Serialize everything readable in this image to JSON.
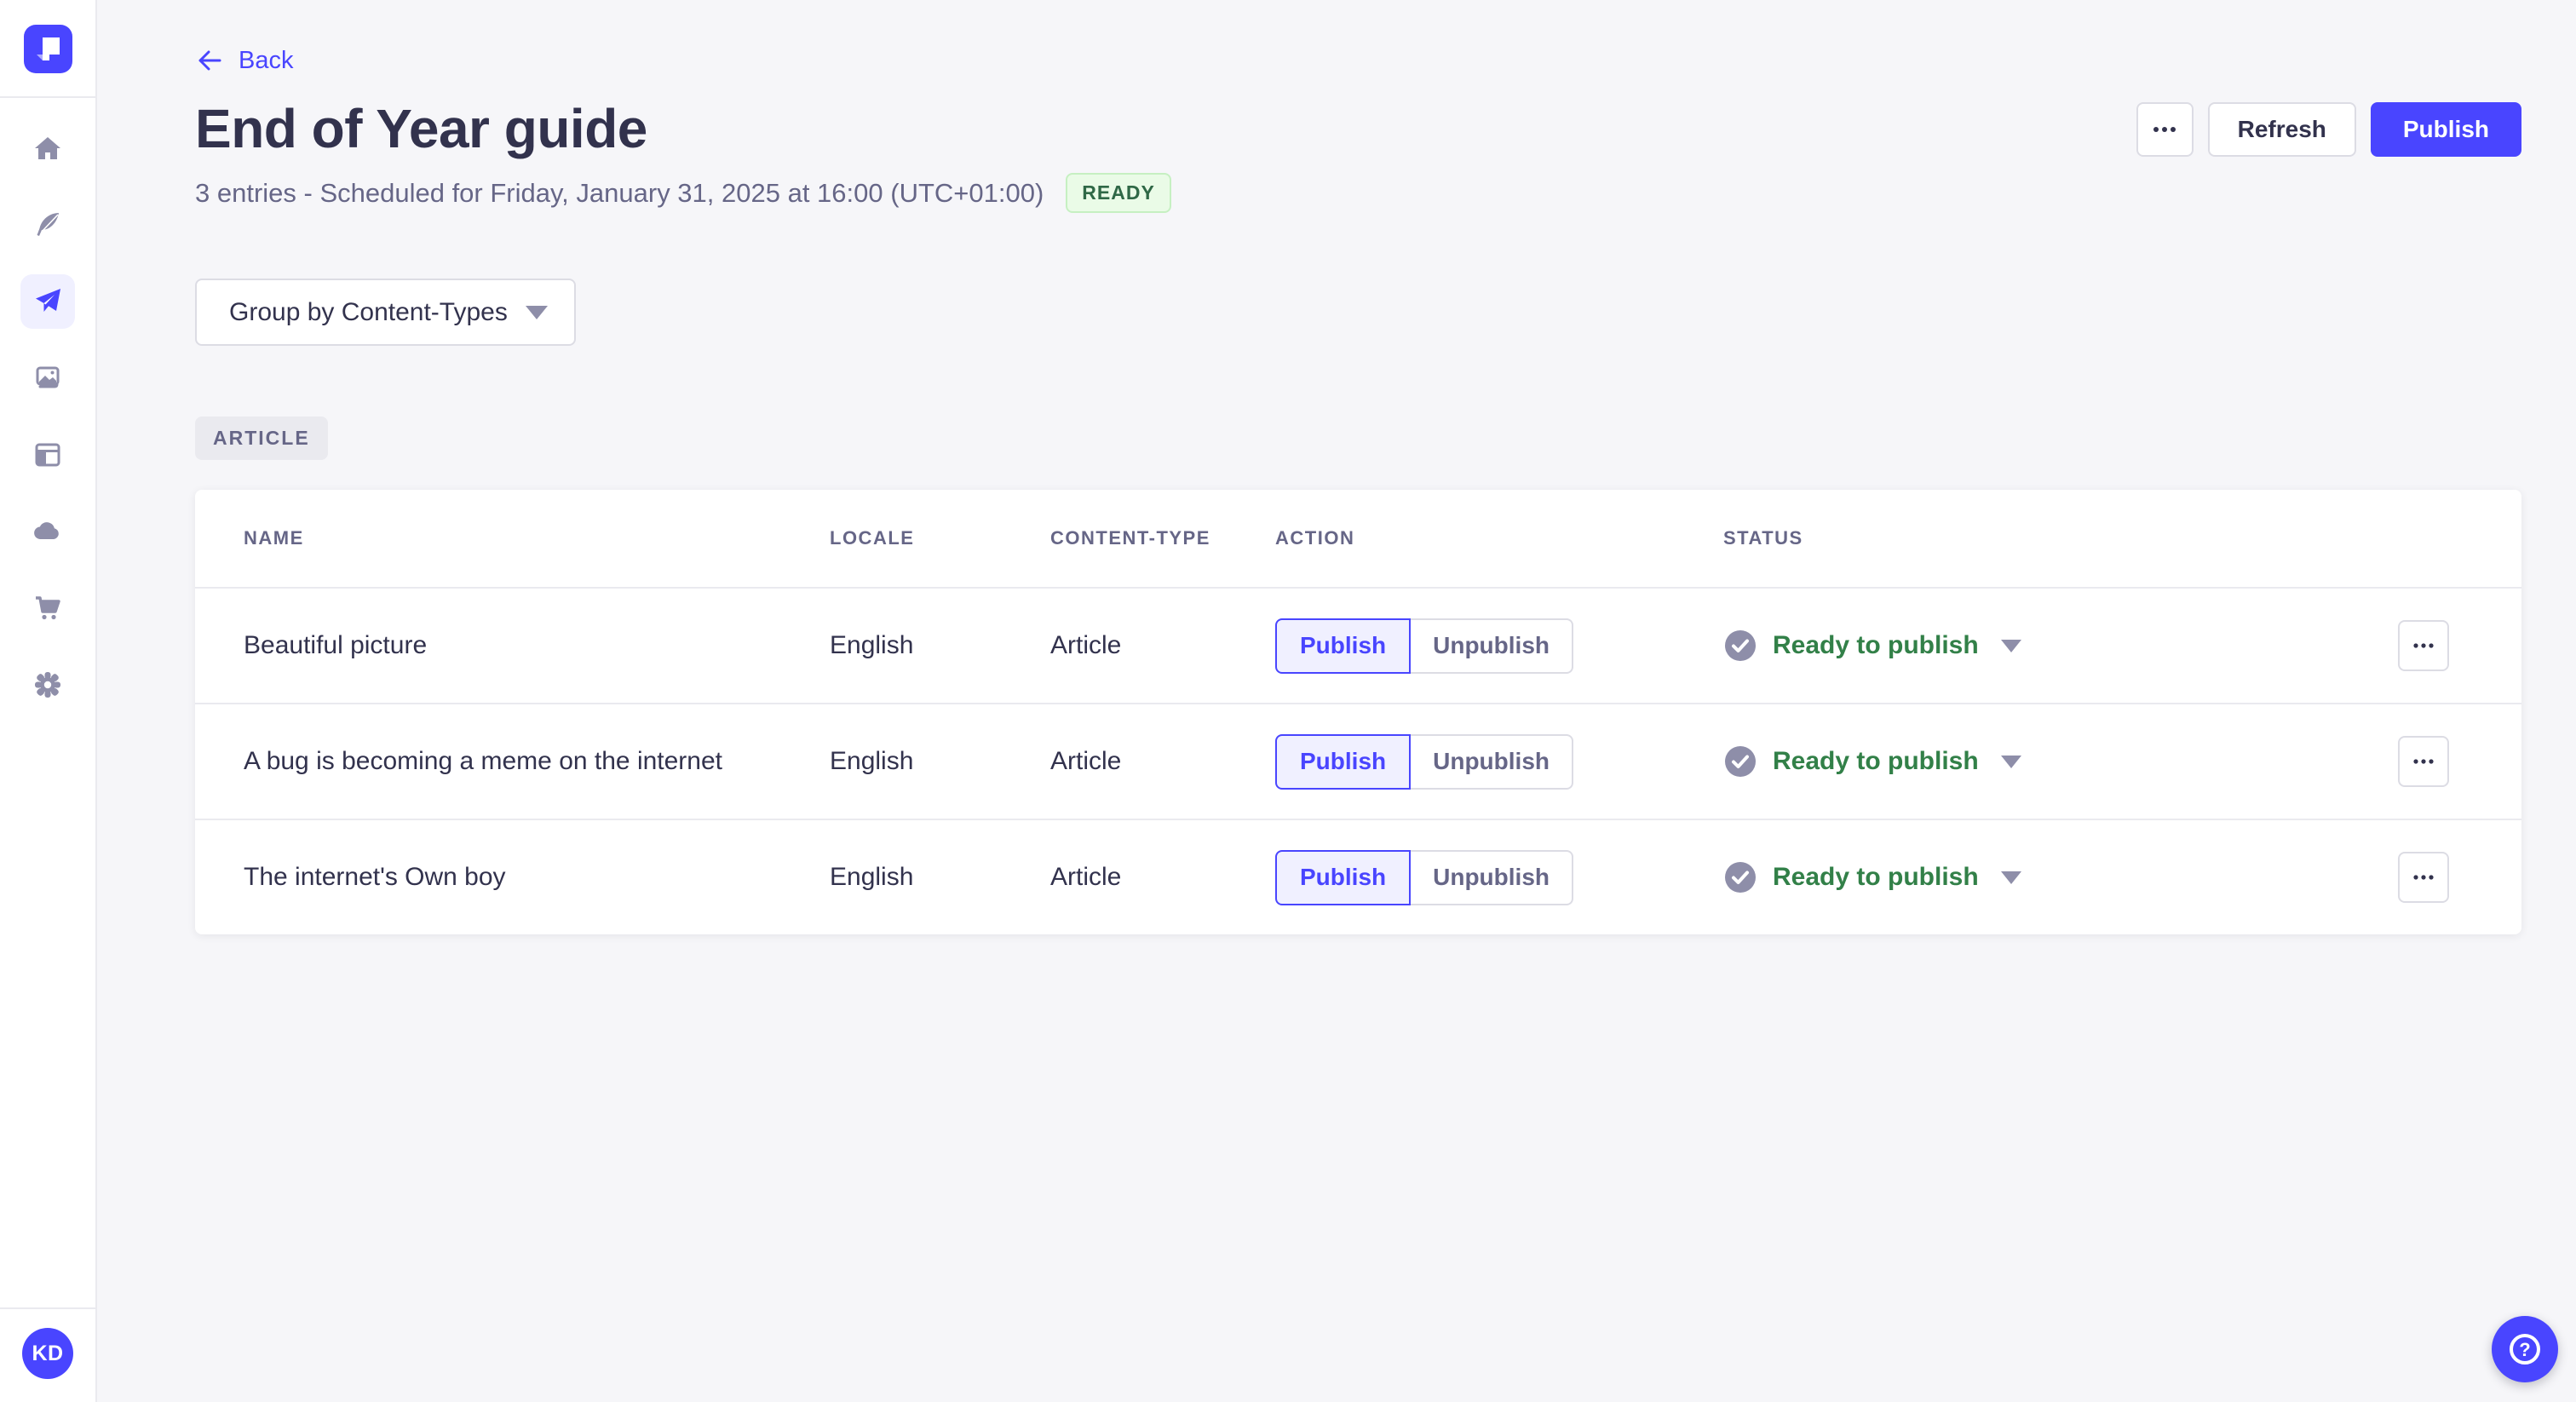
{
  "colors": {
    "primary": "#4945ff",
    "primary_light_bg": "#f0f0ff",
    "text_dark": "#32324d",
    "text_gray": "#666687",
    "icon_gray": "#8e8ea9",
    "border": "#dcdce4",
    "divider": "#eaeaef",
    "page_bg": "#f6f6f9",
    "success_text": "#2f6846",
    "success_status": "#328048",
    "success_bg": "#eafbe7",
    "success_border": "#c6f0c2"
  },
  "sidebar": {
    "logo_icon": "strapi-logo",
    "items": [
      {
        "name": "home",
        "icon": "home-icon",
        "active": false
      },
      {
        "name": "content-manager",
        "icon": "feather-icon",
        "active": false
      },
      {
        "name": "releases",
        "icon": "paper-plane-icon",
        "active": true
      },
      {
        "name": "media-library",
        "icon": "pictures-icon",
        "active": false
      },
      {
        "name": "content-type-builder",
        "icon": "layout-icon",
        "active": false
      },
      {
        "name": "deploy",
        "icon": "cloud-icon",
        "active": false
      },
      {
        "name": "marketplace",
        "icon": "cart-icon",
        "active": false
      },
      {
        "name": "settings",
        "icon": "gear-icon",
        "active": false
      }
    ],
    "avatar_initials": "KD"
  },
  "header": {
    "back_label": "Back",
    "title": "End of Year guide",
    "subtitle": "3 entries - Scheduled for Friday, January 31, 2025 at 16:00 (UTC+01:00)",
    "status_badge": "READY",
    "refresh_label": "Refresh",
    "publish_label": "Publish",
    "more_icon": "ellipsis-icon"
  },
  "toolbar": {
    "group_by_label": "Group by Content-Types"
  },
  "group_label": "ARTICLE",
  "table": {
    "headers": [
      "NAME",
      "LOCALE",
      "CONTENT-TYPE",
      "ACTION",
      "STATUS"
    ],
    "rows": [
      {
        "name": "Beautiful picture",
        "locale": "English",
        "content_type": "Article",
        "publish_label": "Publish",
        "unpublish_label": "Unpublish",
        "status": "Ready to publish"
      },
      {
        "name": "A bug is becoming a meme on the internet",
        "locale": "English",
        "content_type": "Article",
        "publish_label": "Publish",
        "unpublish_label": "Unpublish",
        "status": "Ready to publish"
      },
      {
        "name": "The internet's Own boy",
        "locale": "English",
        "content_type": "Article",
        "publish_label": "Publish",
        "unpublish_label": "Unpublish",
        "status": "Ready to publish"
      }
    ]
  },
  "fab": {
    "label": "?",
    "icon": "help-icon"
  }
}
